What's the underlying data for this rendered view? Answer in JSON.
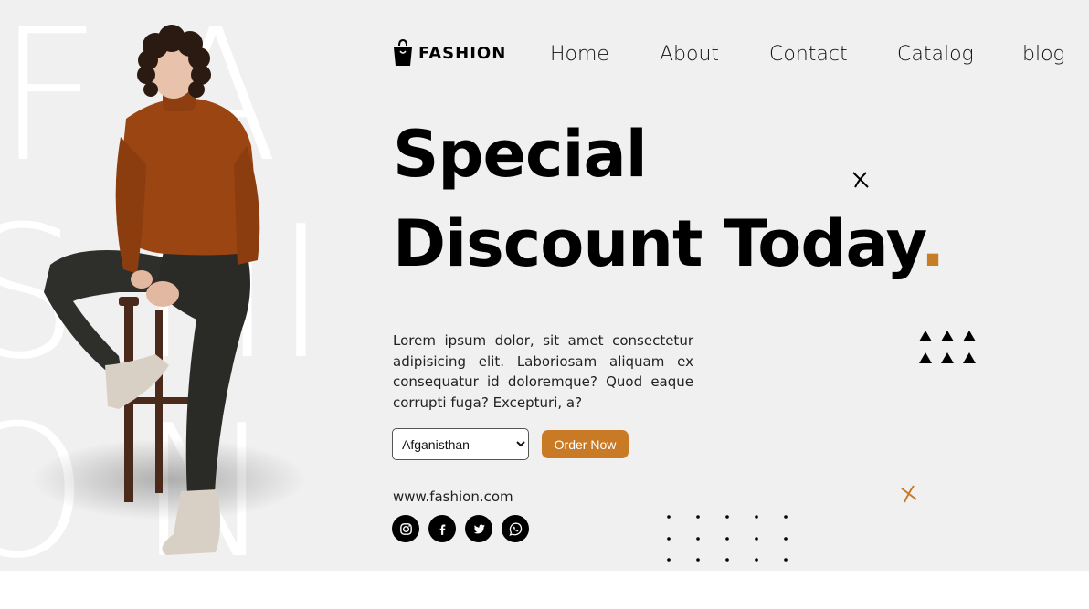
{
  "background_letters": [
    "F",
    "A",
    "S",
    "H",
    "I",
    "O",
    "N"
  ],
  "brand": {
    "name": "FASHION"
  },
  "nav": {
    "items": [
      "Home",
      "About",
      "Contact",
      "Catalog",
      "blog"
    ]
  },
  "hero": {
    "heading_line1": "Special",
    "heading_line2": "Discount Today",
    "heading_dot": ".",
    "description": "Lorem ipsum dolor, sit amet consectetur adipisicing elit. Laboriosam aliquam ex consequatur id doloremque? Quod eaque corrupti fuga? Excepturi, a?",
    "country_select": {
      "selected": "Afganisthan"
    },
    "order_button": "Order Now",
    "website": "www.fashion.com"
  },
  "social": [
    "instagram-icon",
    "facebook-icon",
    "twitter-icon",
    "whatsapp-icon"
  ],
  "colors": {
    "accent": "#c97a25",
    "background": "#f0f0f0",
    "text": "#000000"
  }
}
